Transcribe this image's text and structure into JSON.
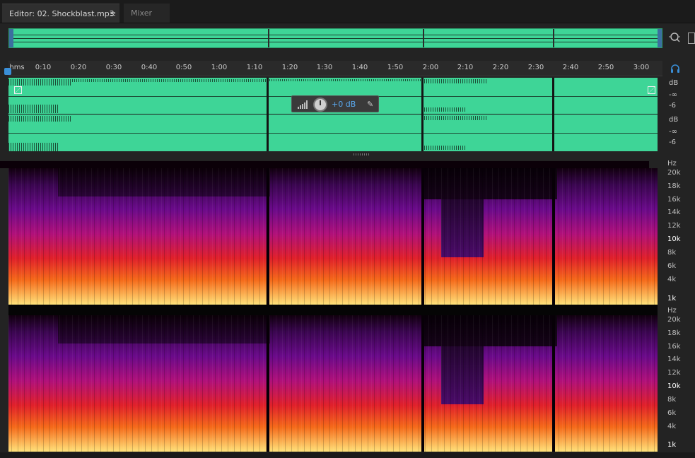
{
  "tabs": {
    "editor_label": "Editor: 02. Shockblast.mp3",
    "menu_glyph": "≡",
    "mixer_label": "Mixer"
  },
  "ruler": {
    "unit_label": "hms",
    "ticks": [
      "0:10",
      "0:20",
      "0:30",
      "0:40",
      "0:50",
      "1:00",
      "1:10",
      "1:20",
      "1:30",
      "1:40",
      "1:50",
      "2:00",
      "2:10",
      "2:20",
      "2:30",
      "2:40",
      "2:50",
      "3:00"
    ]
  },
  "hud": {
    "value": "+0 dB",
    "icons": [
      "level-bars-icon",
      "volume-knob",
      "pin-icon"
    ]
  },
  "db_scale": {
    "unit": "dB",
    "labels": [
      "-∞",
      "-6"
    ]
  },
  "hz_scale": {
    "unit": "Hz",
    "labels": [
      "20k",
      "18k",
      "16k",
      "14k",
      "12k",
      "10k",
      "8k",
      "6k",
      "4k",
      "1k"
    ]
  },
  "colors": {
    "waveform": "#3ed597",
    "accent": "#3a8fd8",
    "spectrogram_low": "#ffe27a",
    "spectrogram_mid": "#e0202a",
    "spectrogram_high": "#6a0a8a"
  }
}
